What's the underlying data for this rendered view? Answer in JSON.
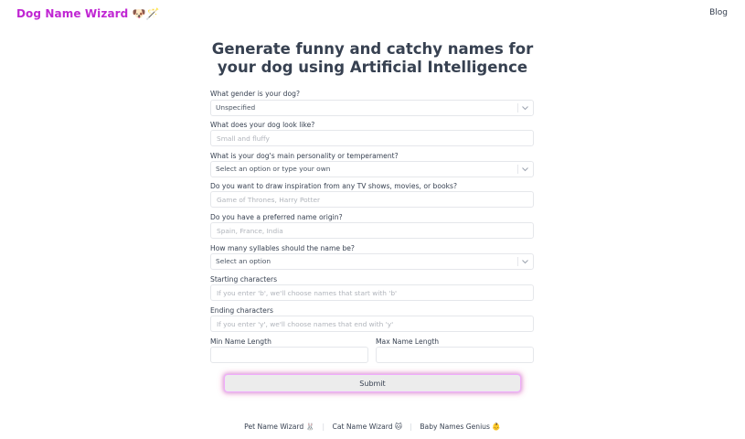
{
  "header": {
    "logo": "Dog Name Wizard 🐶🪄",
    "blog": "Blog"
  },
  "title": {
    "line1": "Generate funny and catchy names for",
    "line2": "your dog using Artificial Intelligence"
  },
  "form": {
    "gender": {
      "label": "What gender is your dog?",
      "value": "Unspecified"
    },
    "look": {
      "label": "What does your dog look like?",
      "placeholder": "Small and fluffy"
    },
    "personality": {
      "label": "What is your dog's main personality or temperament?",
      "placeholder": "Select an option or type your own"
    },
    "inspiration": {
      "label": "Do you want to draw inspiration from any TV shows, movies, or books?",
      "placeholder": "Game of Thrones, Harry Potter"
    },
    "origin": {
      "label": "Do you have a preferred name origin?",
      "placeholder": "Spain, France, India"
    },
    "syllables": {
      "label": "How many syllables should the name be?",
      "placeholder": "Select an option"
    },
    "starting": {
      "label": "Starting characters",
      "placeholder": "If you enter 'b', we'll choose names that start with 'b'"
    },
    "ending": {
      "label": "Ending characters",
      "placeholder": "If you enter 'y', we'll choose names that end with 'y'"
    },
    "min_length": {
      "label": "Min Name Length",
      "placeholder": ""
    },
    "max_length": {
      "label": "Max Name Length",
      "placeholder": ""
    },
    "submit": "Submit"
  },
  "footer": {
    "links": [
      "Pet Name Wizard 🐰",
      "Cat Name Wizard 🐱",
      "Baby Names Genius 👶"
    ]
  },
  "colors": {
    "logo": "#c026d3",
    "submit_glow": "#ec4899"
  }
}
